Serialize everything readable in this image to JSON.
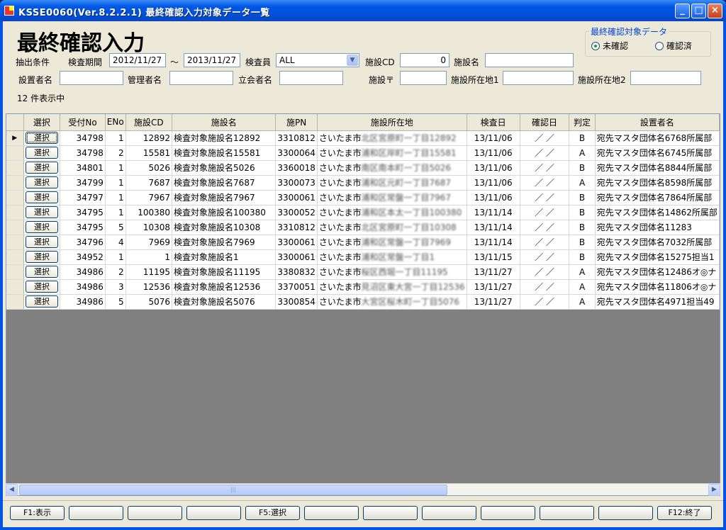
{
  "window": {
    "title": "KSSE0060(Ver.8.2.2.1) 最終確認入力対象データ一覧"
  },
  "heading": "最終確認入力",
  "filters": {
    "label_conditions": "抽出条件",
    "label_period": "検査期間",
    "period_from": "2012/11/27",
    "tilde": "～",
    "period_to": "2013/11/27",
    "label_inspector": "検査員",
    "inspector_value": "ALL",
    "label_facility_cd": "施設CD",
    "facility_cd_value": "0",
    "label_facility_name": "施設名",
    "facility_name_value": "",
    "label_installer": "設置者名",
    "installer_value": "",
    "label_manager": "管理者名",
    "manager_value": "",
    "label_witness": "立会者名",
    "witness_value": "",
    "label_postal": "施設〒",
    "postal_value": "",
    "label_addr1": "施設所在地1",
    "addr1_value": "",
    "label_addr2": "施設所在地2",
    "addr2_value": ""
  },
  "target_group": {
    "title": "最終確認対象データ",
    "option_unconfirmed": "未確認",
    "option_confirmed": "確認済"
  },
  "count_text": "12 件表示中",
  "grid": {
    "headers": [
      "選択",
      "受付No",
      "ENo",
      "施設CD",
      "施設名",
      "施PN",
      "施設所在地",
      "検査日",
      "確認日",
      "判定",
      "設置者名"
    ],
    "select_label": "選択",
    "rows": [
      {
        "receipt": "34798",
        "eno": "1",
        "cd": "12892",
        "name": "検査対象施設名12892",
        "pn": "3310812",
        "addr_a": "さいたま市",
        "addr_b": "北区宮原町一丁目12892",
        "date": "13/11/06",
        "confirm": "／ ／",
        "judge": "B",
        "owner": "宛先マスタ団体名6768所属部"
      },
      {
        "receipt": "34798",
        "eno": "2",
        "cd": "15581",
        "name": "検査対象施設名15581",
        "pn": "3300064",
        "addr_a": "さいたま市",
        "addr_b": "浦和区岸町一丁目15581",
        "date": "13/11/06",
        "confirm": "／ ／",
        "judge": "A",
        "owner": "宛先マスタ団体名6745所属部"
      },
      {
        "receipt": "34801",
        "eno": "1",
        "cd": "5026",
        "name": "検査対象施設名5026",
        "pn": "3360018",
        "addr_a": "さいたま市",
        "addr_b": "南区南本町一丁目5026",
        "date": "13/11/06",
        "confirm": "／ ／",
        "judge": "B",
        "owner": "宛先マスタ団体名8844所属部"
      },
      {
        "receipt": "34799",
        "eno": "1",
        "cd": "7687",
        "name": "検査対象施設名7687",
        "pn": "3300073",
        "addr_a": "さいたま市",
        "addr_b": "浦和区元町一丁目7687",
        "date": "13/11/06",
        "confirm": "／ ／",
        "judge": "A",
        "owner": "宛先マスタ団体名8598所属部"
      },
      {
        "receipt": "34797",
        "eno": "1",
        "cd": "7967",
        "name": "検査対象施設名7967",
        "pn": "3300061",
        "addr_a": "さいたま市",
        "addr_b": "浦和区常盤一丁目7967",
        "date": "13/11/06",
        "confirm": "／ ／",
        "judge": "B",
        "owner": "宛先マスタ団体名7864所属部"
      },
      {
        "receipt": "34795",
        "eno": "1",
        "cd": "100380",
        "name": "検査対象施設名100380",
        "pn": "3300052",
        "addr_a": "さいたま市",
        "addr_b": "浦和区本太一丁目100380",
        "date": "13/11/14",
        "confirm": "／ ／",
        "judge": "B",
        "owner": "宛先マスタ団体名14862所属部"
      },
      {
        "receipt": "34795",
        "eno": "5",
        "cd": "10308",
        "name": "検査対象施設名10308",
        "pn": "3310812",
        "addr_a": "さいたま市",
        "addr_b": "北区宮原町一丁目10308",
        "date": "13/11/14",
        "confirm": "／ ／",
        "judge": "B",
        "owner": "宛先マスタ団体名11283"
      },
      {
        "receipt": "34796",
        "eno": "4",
        "cd": "7969",
        "name": "検査対象施設名7969",
        "pn": "3300061",
        "addr_a": "さいたま市",
        "addr_b": "浦和区常盤一丁目7969",
        "date": "13/11/14",
        "confirm": "／ ／",
        "judge": "B",
        "owner": "宛先マスタ団体名7032所属部"
      },
      {
        "receipt": "34952",
        "eno": "1",
        "cd": "1",
        "name": "検査対象施設名1",
        "pn": "3300061",
        "addr_a": "さいたま市",
        "addr_b": "浦和区常盤一丁目1",
        "date": "13/11/15",
        "confirm": "／ ／",
        "judge": "B",
        "owner": "宛先マスタ団体名15275担当1"
      },
      {
        "receipt": "34986",
        "eno": "2",
        "cd": "11195",
        "name": "検査対象施設名11195",
        "pn": "3380832",
        "addr_a": "さいたま市",
        "addr_b": "桜区西堀一丁目11195",
        "date": "13/11/27",
        "confirm": "／ ／",
        "judge": "A",
        "owner": "宛先マスタ団体名12486オ◎ナ"
      },
      {
        "receipt": "34986",
        "eno": "3",
        "cd": "12536",
        "name": "検査対象施設名12536",
        "pn": "3370051",
        "addr_a": "さいたま市",
        "addr_b": "見沼区東大宮一丁目12536",
        "date": "13/11/27",
        "confirm": "／ ／",
        "judge": "A",
        "owner": "宛先マスタ団体名11806オ◎ナ"
      },
      {
        "receipt": "34986",
        "eno": "5",
        "cd": "5076",
        "name": "検査対象施設名5076",
        "pn": "3300854",
        "addr_a": "さいたま市",
        "addr_b": "大宮区桜木町一丁目5076",
        "date": "13/11/27",
        "confirm": "／ ／",
        "judge": "A",
        "owner": "宛先マスタ団体名4971担当49"
      }
    ]
  },
  "fkeys": [
    "F1:表示",
    "",
    "",
    "",
    "F5:選択",
    "",
    "",
    "",
    "",
    "",
    "",
    "F12:終了"
  ]
}
